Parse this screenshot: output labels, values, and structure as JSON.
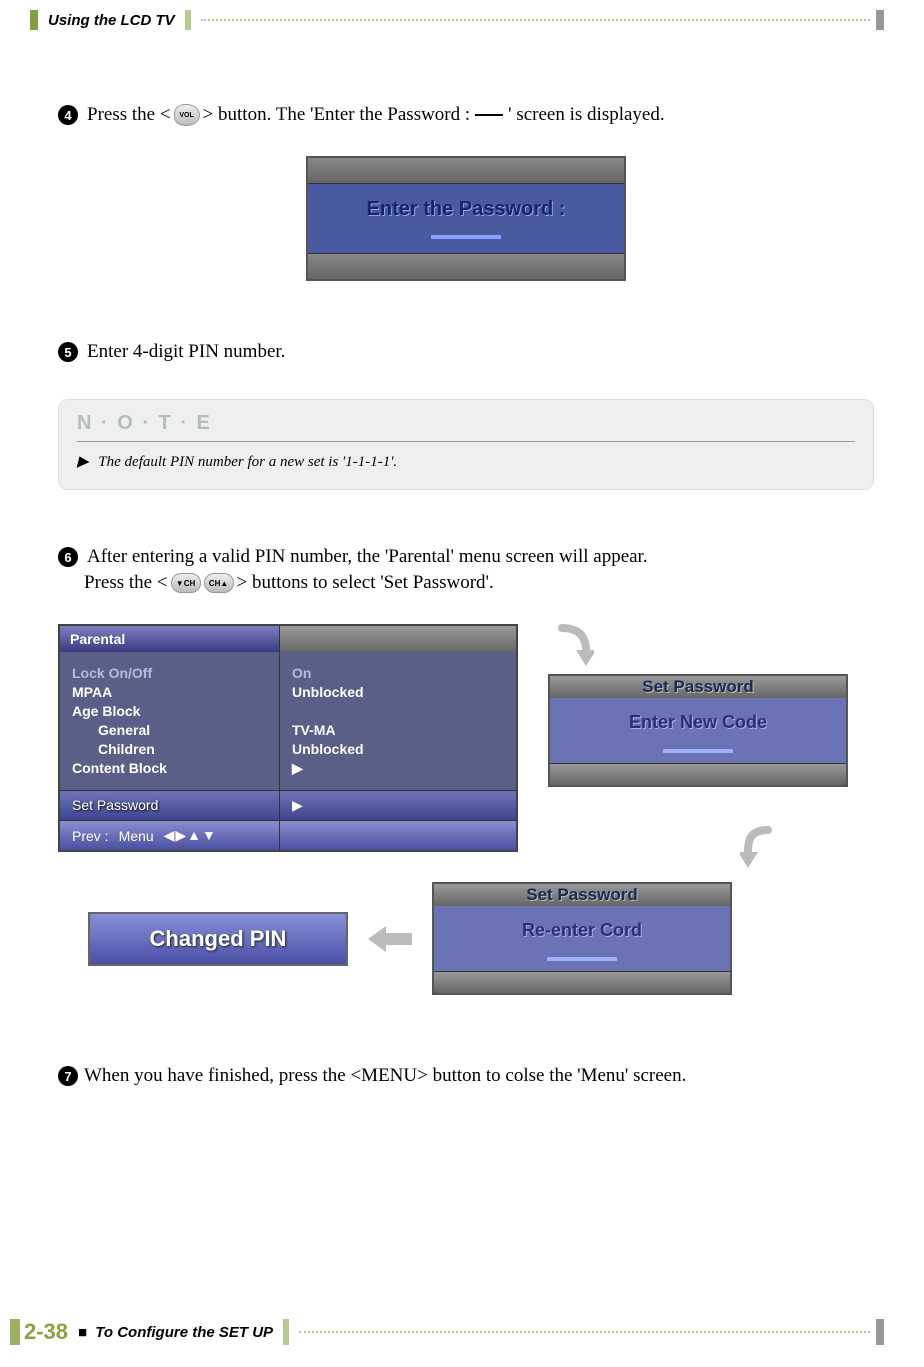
{
  "header": {
    "section_title": "Using the LCD TV"
  },
  "steps": {
    "s4": {
      "num": "4",
      "part_a": "Press the <",
      "vol_label": "VOL",
      "part_b": "> button. The 'Enter the Password : ",
      "part_c": "' screen is displayed."
    },
    "s5": {
      "num": "5",
      "text": "Enter 4-digit PIN number."
    },
    "s6": {
      "num": "6",
      "line1": "After entering a valid PIN number, the 'Parental' menu screen will appear.",
      "line2a": "Press the <",
      "ch_label": "CH",
      "line2b": "> buttons to select 'Set Password'."
    },
    "s7": {
      "num": "7",
      "text": "When you have finished, press the <MENU> button to colse the 'Menu' screen."
    }
  },
  "osd_enter_password": {
    "label": "Enter the Password :"
  },
  "note": {
    "header": "N · O · T · E",
    "triangle": "▶",
    "body": "The default PIN number for a new set is '1-1-1-1'."
  },
  "parental_menu": {
    "title": "Parental",
    "items": {
      "lock": "Lock On/Off",
      "mpaa": "MPAA",
      "age": "Age Block",
      "general": "General",
      "children": "Children",
      "content": "Content Block",
      "setpwd": "Set Password"
    },
    "values": {
      "lock": "On",
      "mpaa": "Unblocked",
      "general": "TV-MA",
      "children": "Unblocked",
      "content": "▶",
      "setpwd": "▶"
    },
    "prev_label": "Prev :",
    "menu_label": "Menu",
    "arrows": "◀▶▲▼"
  },
  "set_password_panel1": {
    "title": "Set Password",
    "label": "Enter New Code"
  },
  "set_password_panel2": {
    "title": "Set Password",
    "label": "Re-enter Cord"
  },
  "changed_pin": {
    "label": "Changed PIN"
  },
  "footer": {
    "page": "2-38",
    "square": "■",
    "section": "To Configure the SET UP"
  }
}
